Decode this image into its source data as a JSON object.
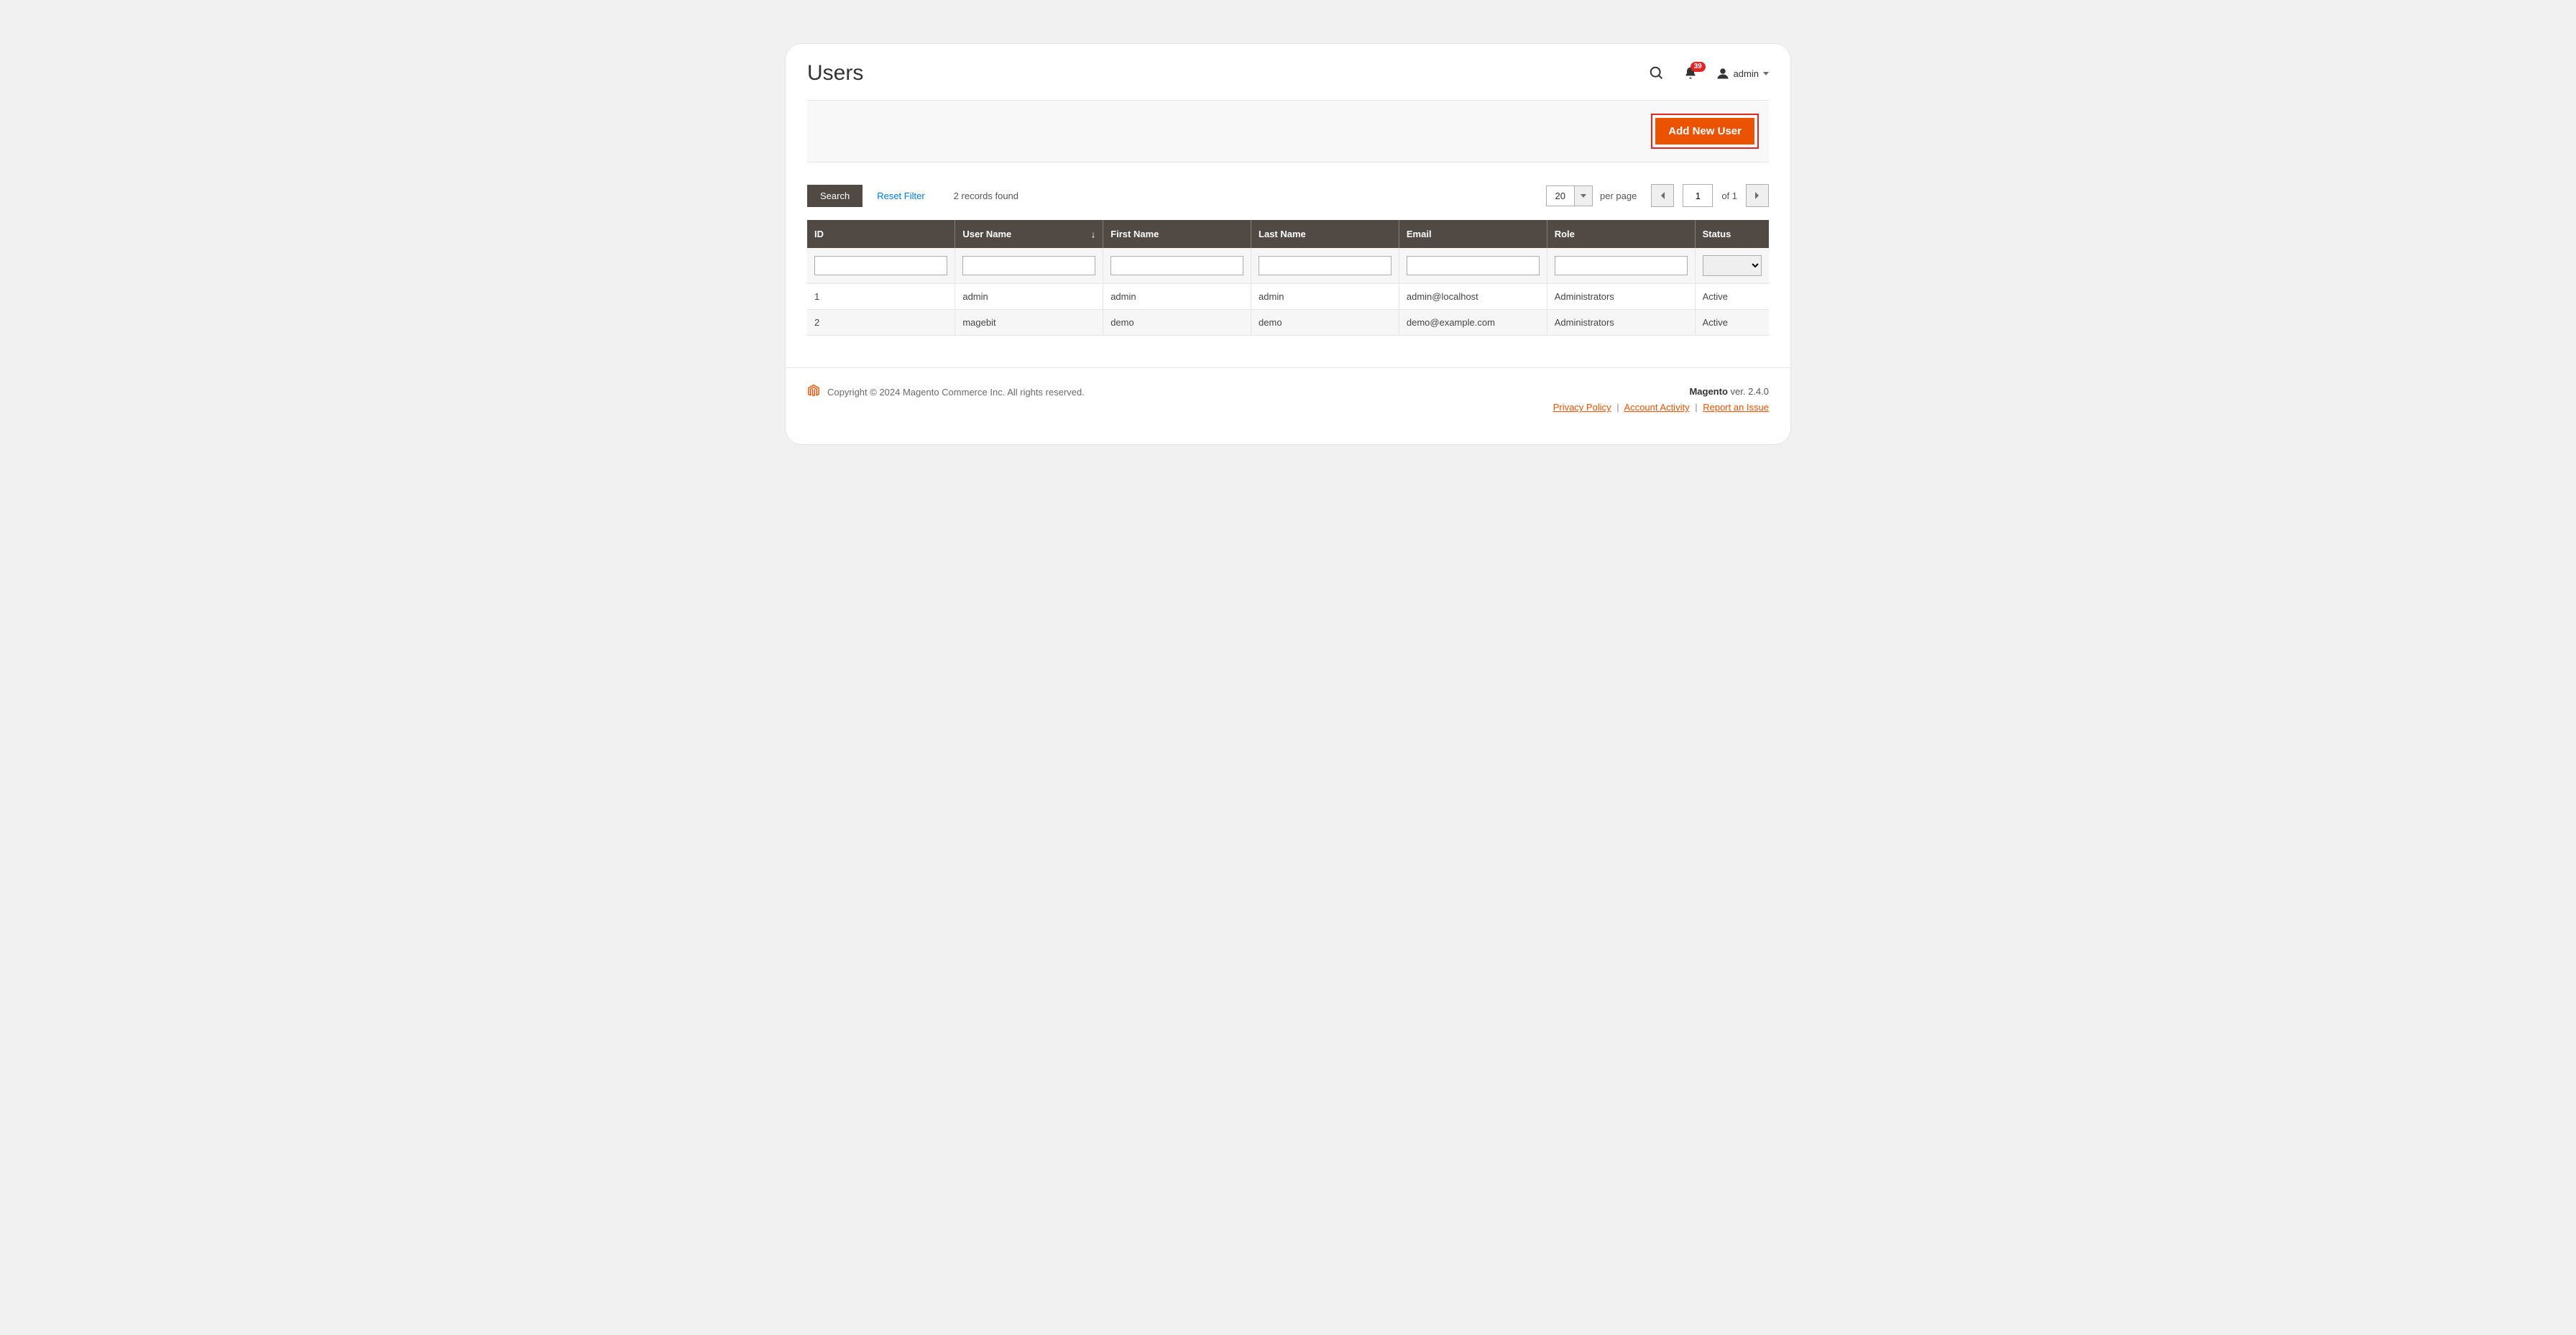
{
  "header": {
    "title": "Users",
    "notifications_count": "39",
    "user_name": "admin"
  },
  "action_bar": {
    "add_button": "Add New User"
  },
  "toolbar": {
    "search_label": "Search",
    "reset_label": "Reset Filter",
    "records_found": "2 records found",
    "per_page_value": "20",
    "per_page_label": "per page",
    "current_page": "1",
    "of_label": "of 1"
  },
  "columns": {
    "id": "ID",
    "user_name": "User Name",
    "first_name": "First Name",
    "last_name": "Last Name",
    "email": "Email",
    "role": "Role",
    "status": "Status"
  },
  "rows": [
    {
      "id": "1",
      "user": "admin",
      "first": "admin",
      "last": "admin",
      "email": "admin@localhost",
      "role": "Administrators",
      "status": "Active"
    },
    {
      "id": "2",
      "user": "magebit",
      "first": "demo",
      "last": "demo",
      "email": "demo@example.com",
      "role": "Administrators",
      "status": "Active"
    }
  ],
  "footer": {
    "copyright": "Copyright © 2024 Magento Commerce Inc. All rights reserved.",
    "brand": "Magento",
    "version": " ver. 2.4.0",
    "links": {
      "privacy": "Privacy Policy",
      "activity": " Account Activity",
      "report": "Report an Issue"
    }
  }
}
